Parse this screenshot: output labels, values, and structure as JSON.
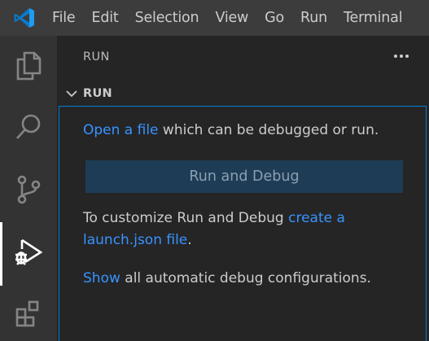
{
  "menu": {
    "items": [
      "File",
      "Edit",
      "Selection",
      "View",
      "Go",
      "Run",
      "Terminal"
    ]
  },
  "activity_bar": {
    "items": [
      {
        "icon": "explorer-icon"
      },
      {
        "icon": "search-icon"
      },
      {
        "icon": "source-control-icon"
      },
      {
        "icon": "run-debug-icon",
        "active": true
      },
      {
        "icon": "extensions-icon"
      }
    ]
  },
  "sidebar": {
    "header": "RUN",
    "section_title": "RUN",
    "open_file_link": "Open a file",
    "open_file_rest": " which can be debugged or run.",
    "run_button_label": "Run and Debug",
    "customize_text": "To customize Run and Debug ",
    "customize_link": "create a launch.json file",
    "customize_end": ".",
    "show_link": "Show",
    "show_rest": " all automatic debug configurations."
  },
  "colors": {
    "accent": "#007acc",
    "link": "#3794ff",
    "titlebar": "#3c3c3c",
    "activitybar": "#333333",
    "sidebar": "#252526",
    "focus_border": "#007fd4"
  }
}
